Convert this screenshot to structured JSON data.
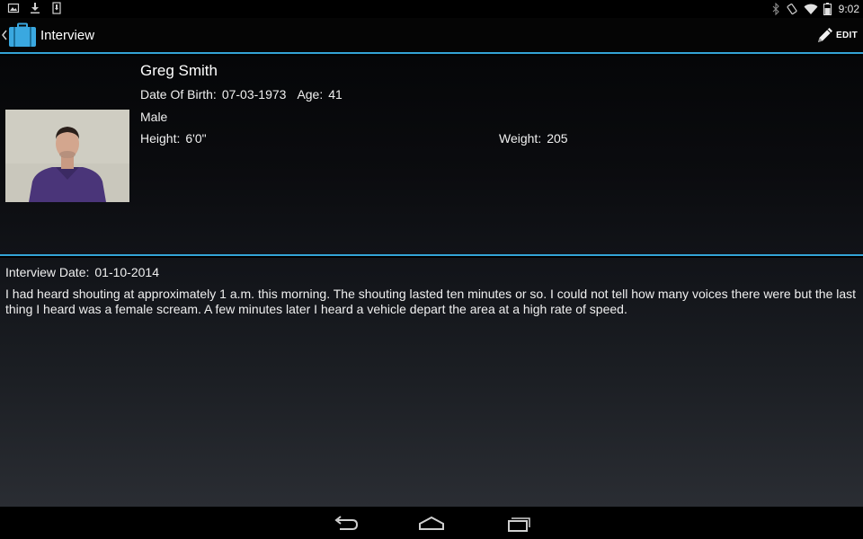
{
  "status_bar": {
    "time": "9:02",
    "left_icons": [
      "image-icon",
      "download-icon",
      "sd-card-icon"
    ],
    "right_icons": [
      "bluetooth-icon",
      "rotate-icon",
      "wifi-icon",
      "battery-icon"
    ]
  },
  "action_bar": {
    "title": "Interview",
    "edit_label": "EDIT",
    "accent_color": "#33a3d6"
  },
  "profile": {
    "name": "Greg Smith",
    "dob_label": "Date Of Birth:",
    "dob_value": "07-03-1973",
    "age_label": "Age:",
    "age_value": "41",
    "gender": "Male",
    "height_label": "Height:",
    "height_value": "6'0\"",
    "weight_label": "Weight:",
    "weight_value": "205"
  },
  "interview": {
    "date_label": "Interview Date:",
    "date_value": "01-10-2014",
    "statement": "I had heard shouting at approximately 1 a.m. this morning. The shouting lasted ten minutes or so. I could not tell how many voices there were but the last thing I heard was a female scream. A few minutes later I heard a vehicle depart the area at a high rate of speed."
  },
  "nav_bar": {
    "buttons": [
      "back-icon",
      "home-icon",
      "recent-apps-icon"
    ]
  }
}
